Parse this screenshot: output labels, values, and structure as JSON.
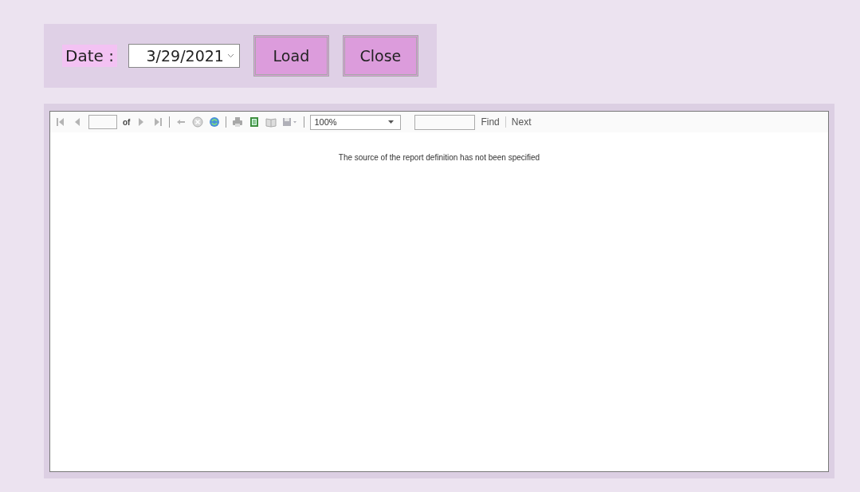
{
  "date_label": "Date :",
  "date_picker": {
    "value": "3/29/2021"
  },
  "buttons": [
    "Load",
    "Close"
  ],
  "report_viewer": {
    "toolbar": {
      "nav_buttons": [
        {
          "kind": "first",
          "disabled": true
        },
        {
          "kind": "prev",
          "disabled": true
        }
      ],
      "of_label": "of",
      "nav_buttons_after": [
        {
          "kind": "next",
          "disabled": true
        },
        {
          "kind": "last",
          "disabled": true
        }
      ],
      "action_buttons": [
        {
          "kind": "back",
          "disabled": true
        },
        {
          "kind": "stop",
          "disabled": true
        },
        {
          "kind": "refresh",
          "disabled": false
        }
      ],
      "output_buttons": [
        {
          "kind": "print",
          "disabled": true
        },
        {
          "kind": "layout",
          "disabled": false
        },
        {
          "kind": "page-setup",
          "disabled": true
        },
        {
          "kind": "export",
          "disabled": true
        }
      ],
      "zoom": {
        "value": "100%"
      },
      "find_link": "Find",
      "next_link": "Next"
    },
    "message": "The source of the report definition has not been specified"
  }
}
